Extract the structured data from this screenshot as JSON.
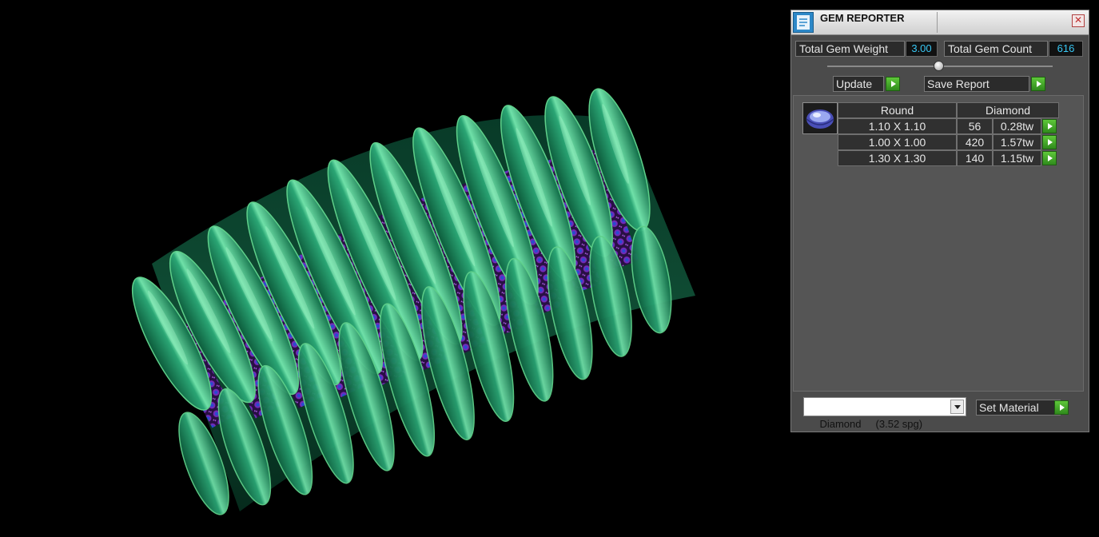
{
  "panel": {
    "title": "GEM REPORTER",
    "total_weight_label": "Total Gem Weight",
    "total_weight_value": "3.00",
    "total_count_label": "Total Gem Count",
    "total_count_value": "616",
    "update_label": "Update",
    "save_report_label": "Save Report",
    "gem_header": {
      "shape": "Round",
      "material": "Diamond"
    },
    "gems": [
      {
        "size": "1.10 X 1.10",
        "count": "56",
        "weight": "0.28tw"
      },
      {
        "size": "1.00 X 1.00",
        "count": "420",
        "weight": "1.57tw"
      },
      {
        "size": "1.30 X 1.30",
        "count": "140",
        "weight": "1.15tw"
      }
    ],
    "material_select": "Diamond     (3.52 spg)",
    "set_material_label": "Set Material",
    "close_symbol": "✕"
  },
  "colors": {
    "background": "#000000",
    "ring_metal": "#1f8f62",
    "ring_edge": "#5fd08a",
    "pave": "#7a28c0",
    "gem_blue": "#2d4ad8",
    "value_text": "#38c7f4",
    "go_button": "#3ea62a"
  },
  "icons": {
    "app": "gem-reporter-app-icon",
    "close": "close-icon",
    "gem": "round-diamond-icon",
    "go": "play-arrow-icon",
    "dropdown": "chevron-down-icon"
  }
}
